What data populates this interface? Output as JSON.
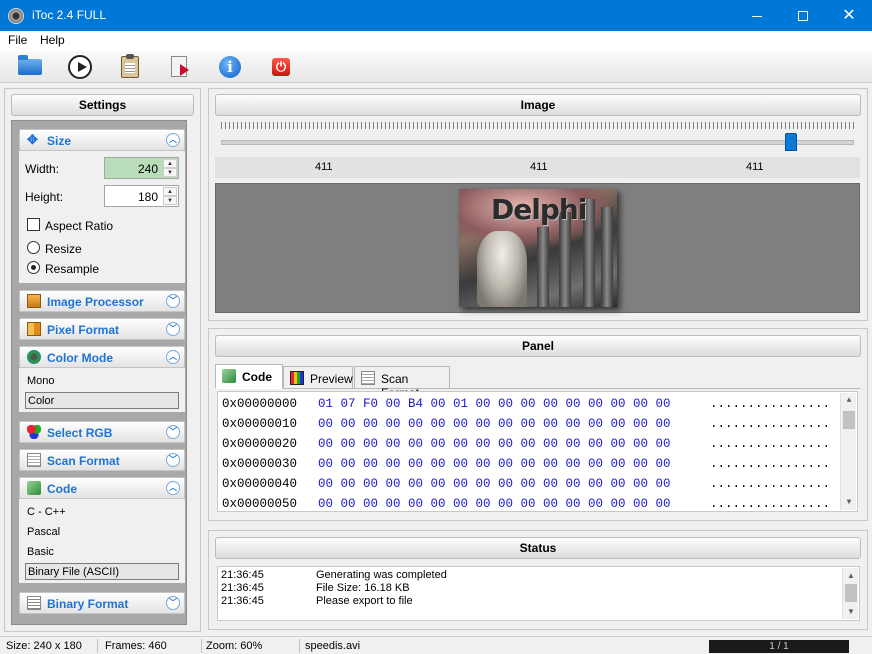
{
  "window": {
    "title": "iToc 2.4  FULL",
    "min_glyph": "—",
    "max_glyph": "□",
    "close_glyph": "✕"
  },
  "menu": {
    "items": [
      "File",
      "Help"
    ]
  },
  "toolbar": {
    "icons": [
      "folder-open-icon",
      "play-icon",
      "clipboard-icon",
      "export-icon",
      "info-icon",
      "power-icon"
    ]
  },
  "settings": {
    "title": "Settings",
    "size": {
      "label": "Size",
      "width_label": "Width:",
      "width_value": "240",
      "height_label": "Height:",
      "height_value": "180",
      "aspect_ratio_label": "Aspect Ratio",
      "aspect_ratio_checked": false,
      "resize_label": "Resize",
      "resample_label": "Resample",
      "selected_mode": "Resample"
    },
    "image_processor": {
      "label": "Image Processor"
    },
    "pixel_format": {
      "label": "Pixel Format"
    },
    "color_mode": {
      "label": "Color Mode",
      "options": [
        "Mono",
        "Color"
      ],
      "selected": "Color"
    },
    "select_rgb": {
      "label": "Select RGB"
    },
    "scan_format": {
      "label": "Scan Format"
    },
    "code": {
      "label": "Code",
      "options": [
        "C - C++",
        "Pascal",
        "Basic",
        "Binary File (ASCII)"
      ],
      "selected": "Binary File (ASCII)"
    },
    "binary_format": {
      "label": "Binary Format"
    }
  },
  "image_panel": {
    "title": "Image",
    "slider_position_fraction": 0.9,
    "ruler": [
      "411",
      "411",
      "411"
    ],
    "preview_text": "Delphi"
  },
  "panel": {
    "title": "Panel",
    "tabs": [
      "Code",
      "Preview",
      "Scan Format"
    ],
    "active_tab": "Code",
    "hex_rows": [
      {
        "addr": "0x00000000",
        "bytes": "01 07 F0 00 B4 00 01 00 00 00 00 00 00 00 00 00",
        "ascii": "................"
      },
      {
        "addr": "0x00000010",
        "bytes": "00 00 00 00 00 00 00 00 00 00 00 00 00 00 00 00",
        "ascii": "................"
      },
      {
        "addr": "0x00000020",
        "bytes": "00 00 00 00 00 00 00 00 00 00 00 00 00 00 00 00",
        "ascii": "................"
      },
      {
        "addr": "0x00000030",
        "bytes": "00 00 00 00 00 00 00 00 00 00 00 00 00 00 00 00",
        "ascii": "................"
      },
      {
        "addr": "0x00000040",
        "bytes": "00 00 00 00 00 00 00 00 00 00 00 00 00 00 00 00",
        "ascii": "................"
      },
      {
        "addr": "0x00000050",
        "bytes": "00 00 00 00 00 00 00 00 00 00 00 00 00 00 00 00",
        "ascii": "................"
      }
    ]
  },
  "status_panel": {
    "title": "Status",
    "log": [
      {
        "time": "21:36:45",
        "message": "Generating was completed"
      },
      {
        "time": "21:36:45",
        "message": "File Size: 16.18 KB"
      },
      {
        "time": "21:36:45",
        "message": "Please export to file"
      }
    ]
  },
  "statusbar": {
    "size": "Size: 240 x 180",
    "frames": "Frames: 460",
    "zoom": "Zoom: 60%",
    "file": "speedis.avi",
    "progress": "1 / 1"
  },
  "colors": {
    "titlebar": "#0078d7",
    "section_text": "#1e73d4",
    "hex_bytes": "#1a1ad2",
    "width_active": "#b9dcb9"
  }
}
